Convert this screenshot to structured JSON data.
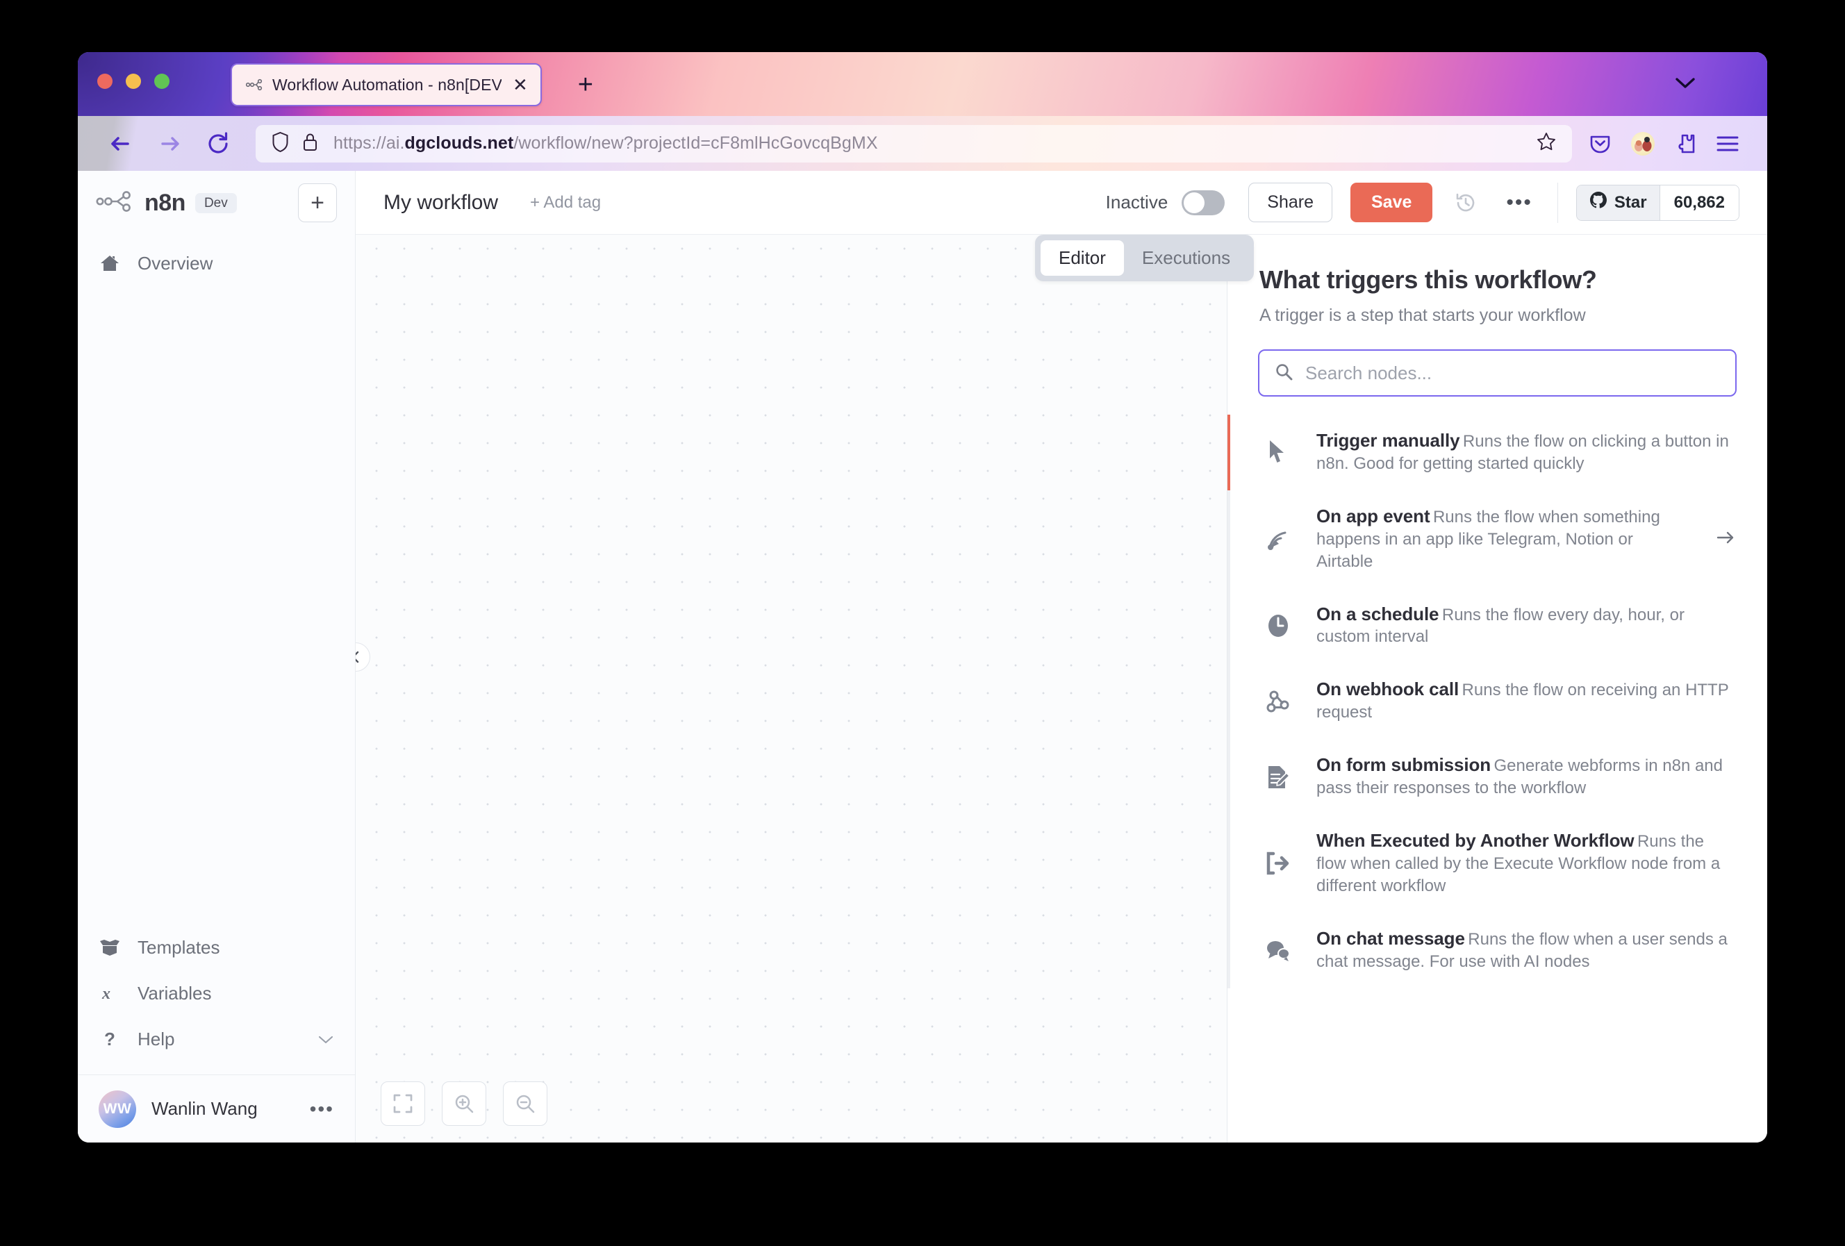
{
  "browser": {
    "tab": {
      "title": "Workflow Automation - n8n[DEV",
      "favicon_name": "n8n-favicon",
      "close_label": "✕"
    },
    "new_tab_label": "+",
    "url": {
      "scheme": "https://ai.",
      "host": "dgclouds.net",
      "path": "/workflow/new?projectId=cF8mlHcGovcqBgMX"
    },
    "toolbar_icons": [
      "pocket-icon",
      "profile-avatar-icon",
      "extensions-icon",
      "menu-icon"
    ]
  },
  "sidebar": {
    "logo_text": "n8n",
    "dev_badge": "Dev",
    "new_workflow_label": "+",
    "top_items": [
      {
        "label": "Overview",
        "icon": "home-icon"
      }
    ],
    "bottom_items": [
      {
        "label": "Templates",
        "icon": "box-icon"
      },
      {
        "label": "Variables",
        "icon": "variable-x-icon"
      },
      {
        "label": "Help",
        "icon": "question-mark-icon",
        "chevron": true
      }
    ],
    "user": {
      "initials": "WW",
      "name": "Wanlin Wang",
      "more_label": "•••"
    }
  },
  "workflow_header": {
    "name": "My workflow",
    "add_tag": "+ Add tag",
    "inactive_label": "Inactive",
    "share_label": "Share",
    "save_label": "Save",
    "more_label": "•••",
    "github": {
      "star_label": "Star",
      "count": "60,862"
    }
  },
  "tabs": [
    {
      "label": "Editor",
      "active": true
    },
    {
      "label": "Executions",
      "active": false
    }
  ],
  "canvas": {
    "controls": [
      {
        "name": "fit-to-view-button",
        "icon": "fit-screen-icon"
      },
      {
        "name": "zoom-in-button",
        "icon": "zoom-in-icon"
      },
      {
        "name": "zoom-out-button",
        "icon": "zoom-out-icon"
      }
    ]
  },
  "panel": {
    "title": "What triggers this workflow?",
    "subtitle": "A trigger is a step that starts your workflow",
    "search_placeholder": "Search nodes...",
    "search_value": "",
    "nodes": [
      {
        "title": "Trigger manually",
        "desc": "Runs the flow on clicking a button in n8n. Good for getting started quickly",
        "icon": "mouse-pointer-icon",
        "hovered": true,
        "arrow": false
      },
      {
        "title": "On app event",
        "desc": "Runs the flow when something happens in an app like Telegram, Notion or Airtable",
        "icon": "satellite-dish-icon",
        "hovered": false,
        "arrow": true
      },
      {
        "title": "On a schedule",
        "desc": "Runs the flow every day, hour, or custom interval",
        "icon": "clock-icon",
        "hovered": false,
        "arrow": false
      },
      {
        "title": "On webhook call",
        "desc": "Runs the flow on receiving an HTTP request",
        "icon": "webhook-icon",
        "hovered": false,
        "arrow": false
      },
      {
        "title": "On form submission",
        "desc": "Generate webforms in n8n and pass their responses to the workflow",
        "icon": "form-edit-icon",
        "hovered": false,
        "arrow": false
      },
      {
        "title": "When Executed by Another Workflow",
        "desc": "Runs the flow when called by the Execute Workflow node from a different workflow",
        "icon": "sign-out-icon",
        "hovered": false,
        "arrow": false
      },
      {
        "title": "On chat message",
        "desc": "Runs the flow when a user sends a chat message. For use with AI nodes",
        "icon": "chat-bubble-icon",
        "hovered": false,
        "arrow": false
      }
    ]
  },
  "colors": {
    "accent_red": "#ea6a56",
    "focus_purple": "#7b68ee",
    "text_dark": "#2f2f38",
    "text_muted": "#80848e"
  }
}
